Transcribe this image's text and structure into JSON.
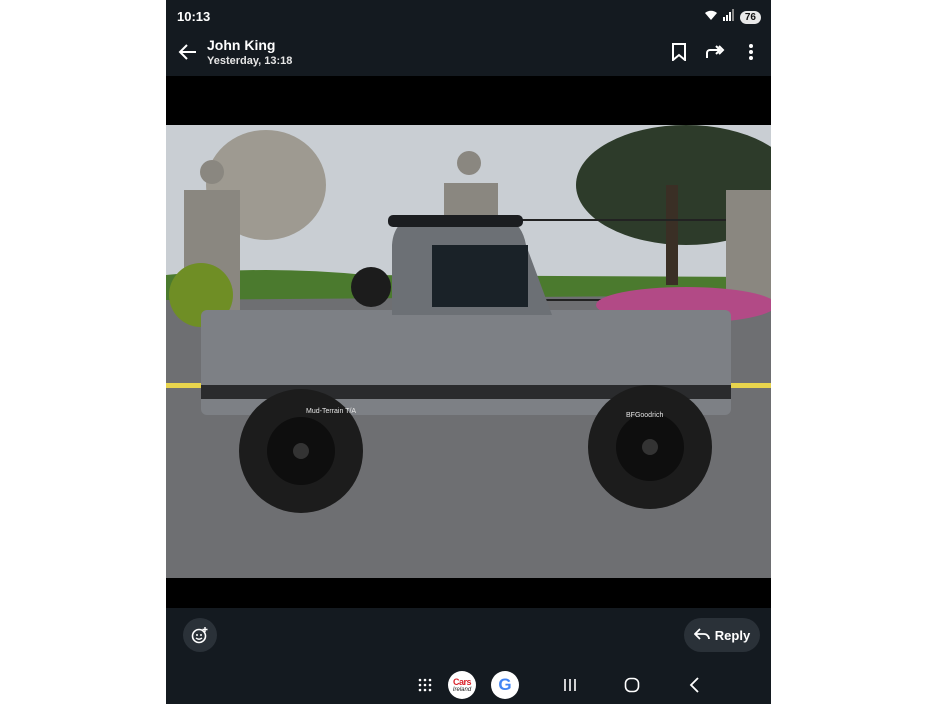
{
  "status_bar": {
    "time": "10:13",
    "battery": "76",
    "icons": [
      "wifi-icon",
      "signal-icon"
    ]
  },
  "header": {
    "sender": "John King",
    "timestamp": "Yesterday, 13:18",
    "actions": [
      "bookmark-icon",
      "forward-icon",
      "more-options-icon"
    ]
  },
  "photo": {
    "subject": "Grey pickup truck with black wheels",
    "tire_text": [
      "Mud-Terrain T/A",
      "BFGoodrich"
    ]
  },
  "footer": {
    "reply_label": "Reply",
    "react_icon": "add-reaction-icon"
  },
  "nav_bar": {
    "apps": [
      {
        "name": "apps-grid-icon"
      },
      {
        "name": "cars-ireland-app",
        "label_top": "Cars",
        "label_bottom": "Ireland"
      },
      {
        "name": "google-app",
        "label": "G"
      }
    ],
    "buttons": [
      "recents-icon",
      "home-icon",
      "back-icon"
    ]
  },
  "colors": {
    "bar": "#141a20",
    "button": "#2a3138",
    "truck": "#7d8085"
  }
}
